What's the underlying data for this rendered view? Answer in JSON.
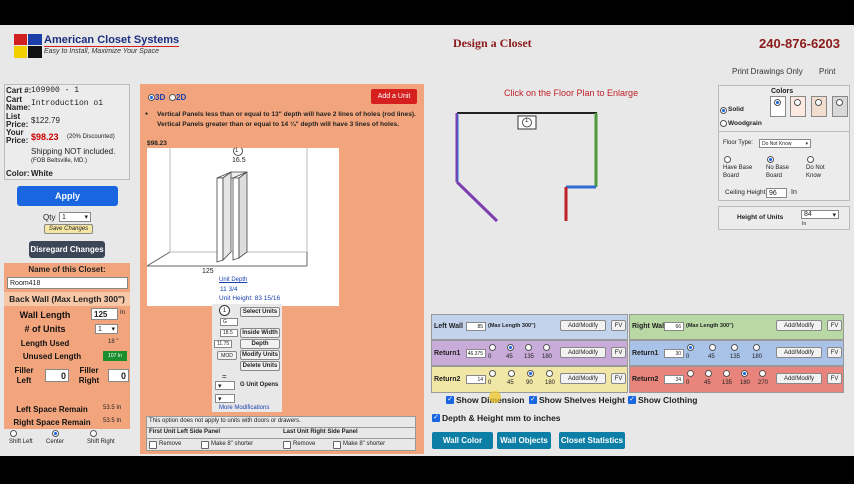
{
  "logo": {
    "name": "American Closet Systems",
    "tagline": "Easy to Install, Maximize Your Space"
  },
  "title": "Design a Closet",
  "phone": "240-876-6203",
  "top_links": {
    "print_only": "Print Drawings Only",
    "print": "Print"
  },
  "cart": {
    "cart_label": "Cart #:",
    "cart_value": "109900 - 1",
    "name_label": "Cart Name:",
    "name_value": "Introduction o1",
    "list_label": "List Price:",
    "list_value": "$122.79",
    "your_label": "Your Price:",
    "your_value": "$98.23",
    "discount": "(20% Discounted)",
    "shipping": "Shipping NOT included.",
    "fob": "(FOB Beltsville, MD.)",
    "color_label": "Color:",
    "color_value": "White"
  },
  "apply_label": "Apply",
  "qty_label": "Qty",
  "qty_value": "1",
  "save_changes": "Save Changes",
  "disregard": "Disregard Changes",
  "closet_name_label": "Name of this Closet:",
  "closet_name_value": "Room418",
  "back_wall": "Back Wall (Max Length 300\")",
  "wall_length_label": "Wall Length",
  "wall_length_value": "125",
  "wall_length_unit": "In",
  "units_label": "# of Units",
  "units_value": "1",
  "length_used_label": "Length Used",
  "length_used_value": "18 \"",
  "unused_label": "Unused Length",
  "unused_value": "107 In",
  "filler_left_label": "Filler Left",
  "filler_left_value": "0",
  "filler_right_label": "Filler Right",
  "filler_right_value": "0",
  "left_space_label": "Left Space Remain",
  "left_space_value": "53.5 In",
  "right_space_label": "Right Space Remain",
  "right_space_value": "53.5 In",
  "shift": {
    "left": "Shift Left",
    "center": "Center",
    "right": "Shift Right"
  },
  "view": {
    "d3": "3D",
    "d2": "2D"
  },
  "add_unit": "Add a Unit",
  "notice": "Vertical Panels less than or equal to 13\" depth will have 2 lines of holes (rod lines). Vertical Panels greater than or equal to 14 ¼\" depth will have 3 lines of holes.",
  "preview": {
    "price": "$98.23",
    "unit_no": "1",
    "top_dim": "16.5",
    "bottom_dim": "125",
    "unit_depth_link": "Unit Depth",
    "depth_val": "11 3/4",
    "height_text": "Unit Height: 83 15/16"
  },
  "unit_controls": {
    "unit_no": "1",
    "select_units": "Select Units",
    "inside_width": "Inside Width",
    "inside_width_val": "18.5",
    "depth": "Depth",
    "depth_val": "11.75",
    "mod": "MOD",
    "modify_units": "Modify Units",
    "delete_units": "Delete Units",
    "eq": "=",
    "g_units": "G Unit Opens",
    "more": "More Modifications"
  },
  "option_note": "This option does not apply to units with doors or drawers.",
  "first_panel": "First Unit Left Side Panel",
  "last_panel": "Last Unit Right Side Panel",
  "remove": "Remove",
  "shorter": "Make 8\" shorter",
  "floor_plan_hint": "Click on the Floor Plan to Enlarge",
  "floor_plan_label": "1",
  "colors": {
    "title": "Colors",
    "solid": "Solid",
    "woodgrain": "Woodgrain",
    "swatches": [
      "#ffffff",
      "#fde9e0",
      "#f2dccd",
      "#d8d8d8"
    ],
    "floor_type_label": "Floor Type:",
    "floor_type_value": "Do Not Know",
    "base_have": "Have Base Board",
    "base_no": "No Base Board",
    "base_dunno": "Do Not Know",
    "ceiling_label": "Ceiling Height",
    "ceiling_value": "96",
    "ceiling_unit": "In",
    "height_units_label": "Height of Units",
    "height_units_value": "84",
    "height_units_unit": "In"
  },
  "walls": {
    "left": {
      "label": "Left Wall",
      "value": "85",
      "max": "(Max Length 300\")",
      "btn": "Add/Modify",
      "fv": "FV"
    },
    "right": {
      "label": "Right Wall",
      "value": "66",
      "max": "(Max Length 300\")",
      "btn": "Add/Modify",
      "fv": "FV"
    },
    "return1_left": {
      "label": "Return1",
      "value": "46.375",
      "angles": [
        "0",
        "45",
        "135",
        "180"
      ],
      "btn": "Add/Modify",
      "fv": "FV"
    },
    "return2_left": {
      "label": "Return2",
      "value": "14",
      "angles": [
        "0",
        "45",
        "90",
        "180"
      ],
      "btn": "Add/Modify",
      "fv": "FV"
    },
    "return1_right": {
      "label": "Return1",
      "value": "30",
      "angles": [
        "0",
        "45",
        "135",
        "180"
      ],
      "btn": "Add/Modify",
      "fv": "FV"
    },
    "return2_right": {
      "label": "Return2",
      "value": "34",
      "angles": [
        "0",
        "45",
        "135",
        "180",
        "270"
      ],
      "btn": "Add/Modify",
      "fv": "FV"
    }
  },
  "toggles": {
    "dimension": "Show Dimension",
    "shelves": "Show Shelves Height",
    "clothing": "Show Clothing",
    "mm": "Depth & Height mm to inches"
  },
  "bottom_buttons": {
    "wall_color": "Wall Color",
    "wall_objects": "Wall Objects",
    "stats": "Closet Statistics"
  }
}
